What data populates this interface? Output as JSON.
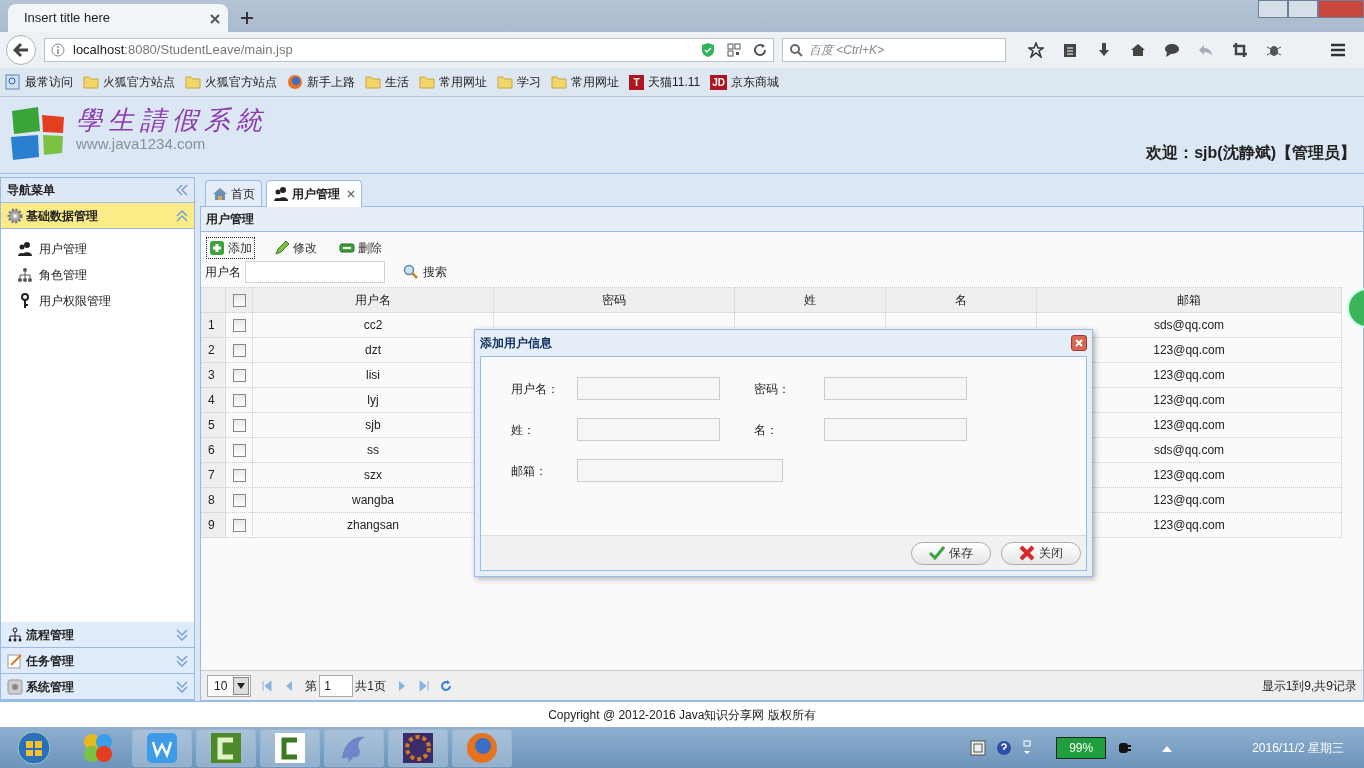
{
  "browser": {
    "tab_title": "Insert title here",
    "url_host": "localhost",
    "url_rest": ":8080/StudentLeave/main.jsp",
    "search_placeholder": "百度 <Ctrl+K>",
    "bookmarks": [
      {
        "label": "最常访问",
        "kind": "recent"
      },
      {
        "label": "火狐官方站点",
        "kind": "folder"
      },
      {
        "label": "火狐官方站点",
        "kind": "folder"
      },
      {
        "label": "新手上路",
        "kind": "firefox"
      },
      {
        "label": "生活",
        "kind": "folder"
      },
      {
        "label": "常用网址",
        "kind": "folder"
      },
      {
        "label": "学习",
        "kind": "folder"
      },
      {
        "label": "常用网址",
        "kind": "folder"
      },
      {
        "label": "天猫11.11",
        "kind": "badge",
        "badge": "T"
      },
      {
        "label": "京东商城",
        "kind": "badge",
        "badge": "JD"
      }
    ]
  },
  "header": {
    "logo_title": "學生請假系統",
    "logo_url": "www.java1234.com",
    "welcome": "欢迎：sjb(沈静斌)【管理员】"
  },
  "sidebar": {
    "title": "导航菜单",
    "groups": [
      {
        "label": "基础数据管理",
        "kind": "gear",
        "expanded": true,
        "items": [
          {
            "label": "用户管理",
            "kind": "users"
          },
          {
            "label": "角色管理",
            "kind": "hierarchy"
          },
          {
            "label": "用户权限管理",
            "kind": "key"
          }
        ]
      },
      {
        "label": "流程管理",
        "kind": "flow",
        "expanded": false
      },
      {
        "label": "任务管理",
        "kind": "note",
        "expanded": false
      },
      {
        "label": "系统管理",
        "kind": "system",
        "expanded": false
      }
    ]
  },
  "tabs": [
    {
      "label": "首页",
      "kind": "home",
      "selected": false,
      "closable": false
    },
    {
      "label": "用户管理",
      "kind": "users",
      "selected": true,
      "closable": true
    }
  ],
  "panel": {
    "title": "用户管理",
    "toolbar": [
      {
        "label": "添加",
        "kind": "add",
        "focused": true
      },
      {
        "label": "修改",
        "kind": "edit",
        "focused": false
      },
      {
        "label": "删除",
        "kind": "remove",
        "focused": false
      }
    ],
    "search_label": "用户名",
    "search_button": "搜索",
    "table": {
      "all_checked": false,
      "columns": [
        "用户名",
        "密码",
        "姓",
        "名",
        "邮箱"
      ],
      "rows": [
        {
          "num": "1",
          "checked": false,
          "username": "cc2",
          "email": "sds@qq.com"
        },
        {
          "num": "2",
          "checked": false,
          "username": "dzt",
          "email": "123@qq.com"
        },
        {
          "num": "3",
          "checked": false,
          "username": "lisi",
          "email": "123@qq.com"
        },
        {
          "num": "4",
          "checked": false,
          "username": "lyj",
          "email": "123@qq.com"
        },
        {
          "num": "5",
          "checked": false,
          "username": "sjb",
          "email": "123@qq.com"
        },
        {
          "num": "6",
          "checked": false,
          "username": "ss",
          "email": "sds@qq.com"
        },
        {
          "num": "7",
          "checked": false,
          "username": "szx",
          "email": "123@qq.com"
        },
        {
          "num": "8",
          "checked": false,
          "username": "wangba",
          "email": "123@qq.com"
        },
        {
          "num": "9",
          "checked": false,
          "username": "zhangsan",
          "email": "123@qq.com"
        }
      ]
    },
    "pager": {
      "page_size": "10",
      "page_prefix": "第",
      "page": "1",
      "total_pages": "共1页",
      "summary": "显示1到9,共9记录"
    }
  },
  "dialog": {
    "title": "添加用户信息",
    "fields": [
      {
        "label": "用户名：",
        "wide": false
      },
      {
        "label": "密码：",
        "wide": false
      },
      {
        "label": "姓：",
        "wide": false
      },
      {
        "label": "名：",
        "wide": false
      },
      {
        "label": "邮箱：",
        "wide": true
      }
    ],
    "buttons": [
      {
        "label": "保存",
        "kind": "save"
      },
      {
        "label": "关闭",
        "kind": "close"
      }
    ]
  },
  "footer": "Copyright @ 2012-2016 Java知识分享网 版权所有",
  "taskbar": {
    "apps": [
      {
        "kind": "start"
      },
      {
        "kind": "colorful"
      },
      {
        "kind": "w"
      },
      {
        "kind": "c-dark"
      },
      {
        "kind": "c-light"
      },
      {
        "kind": "dolphin"
      },
      {
        "kind": "ide"
      },
      {
        "kind": "browser"
      }
    ],
    "battery": "99%",
    "date": "2016/11/2 星期三"
  }
}
